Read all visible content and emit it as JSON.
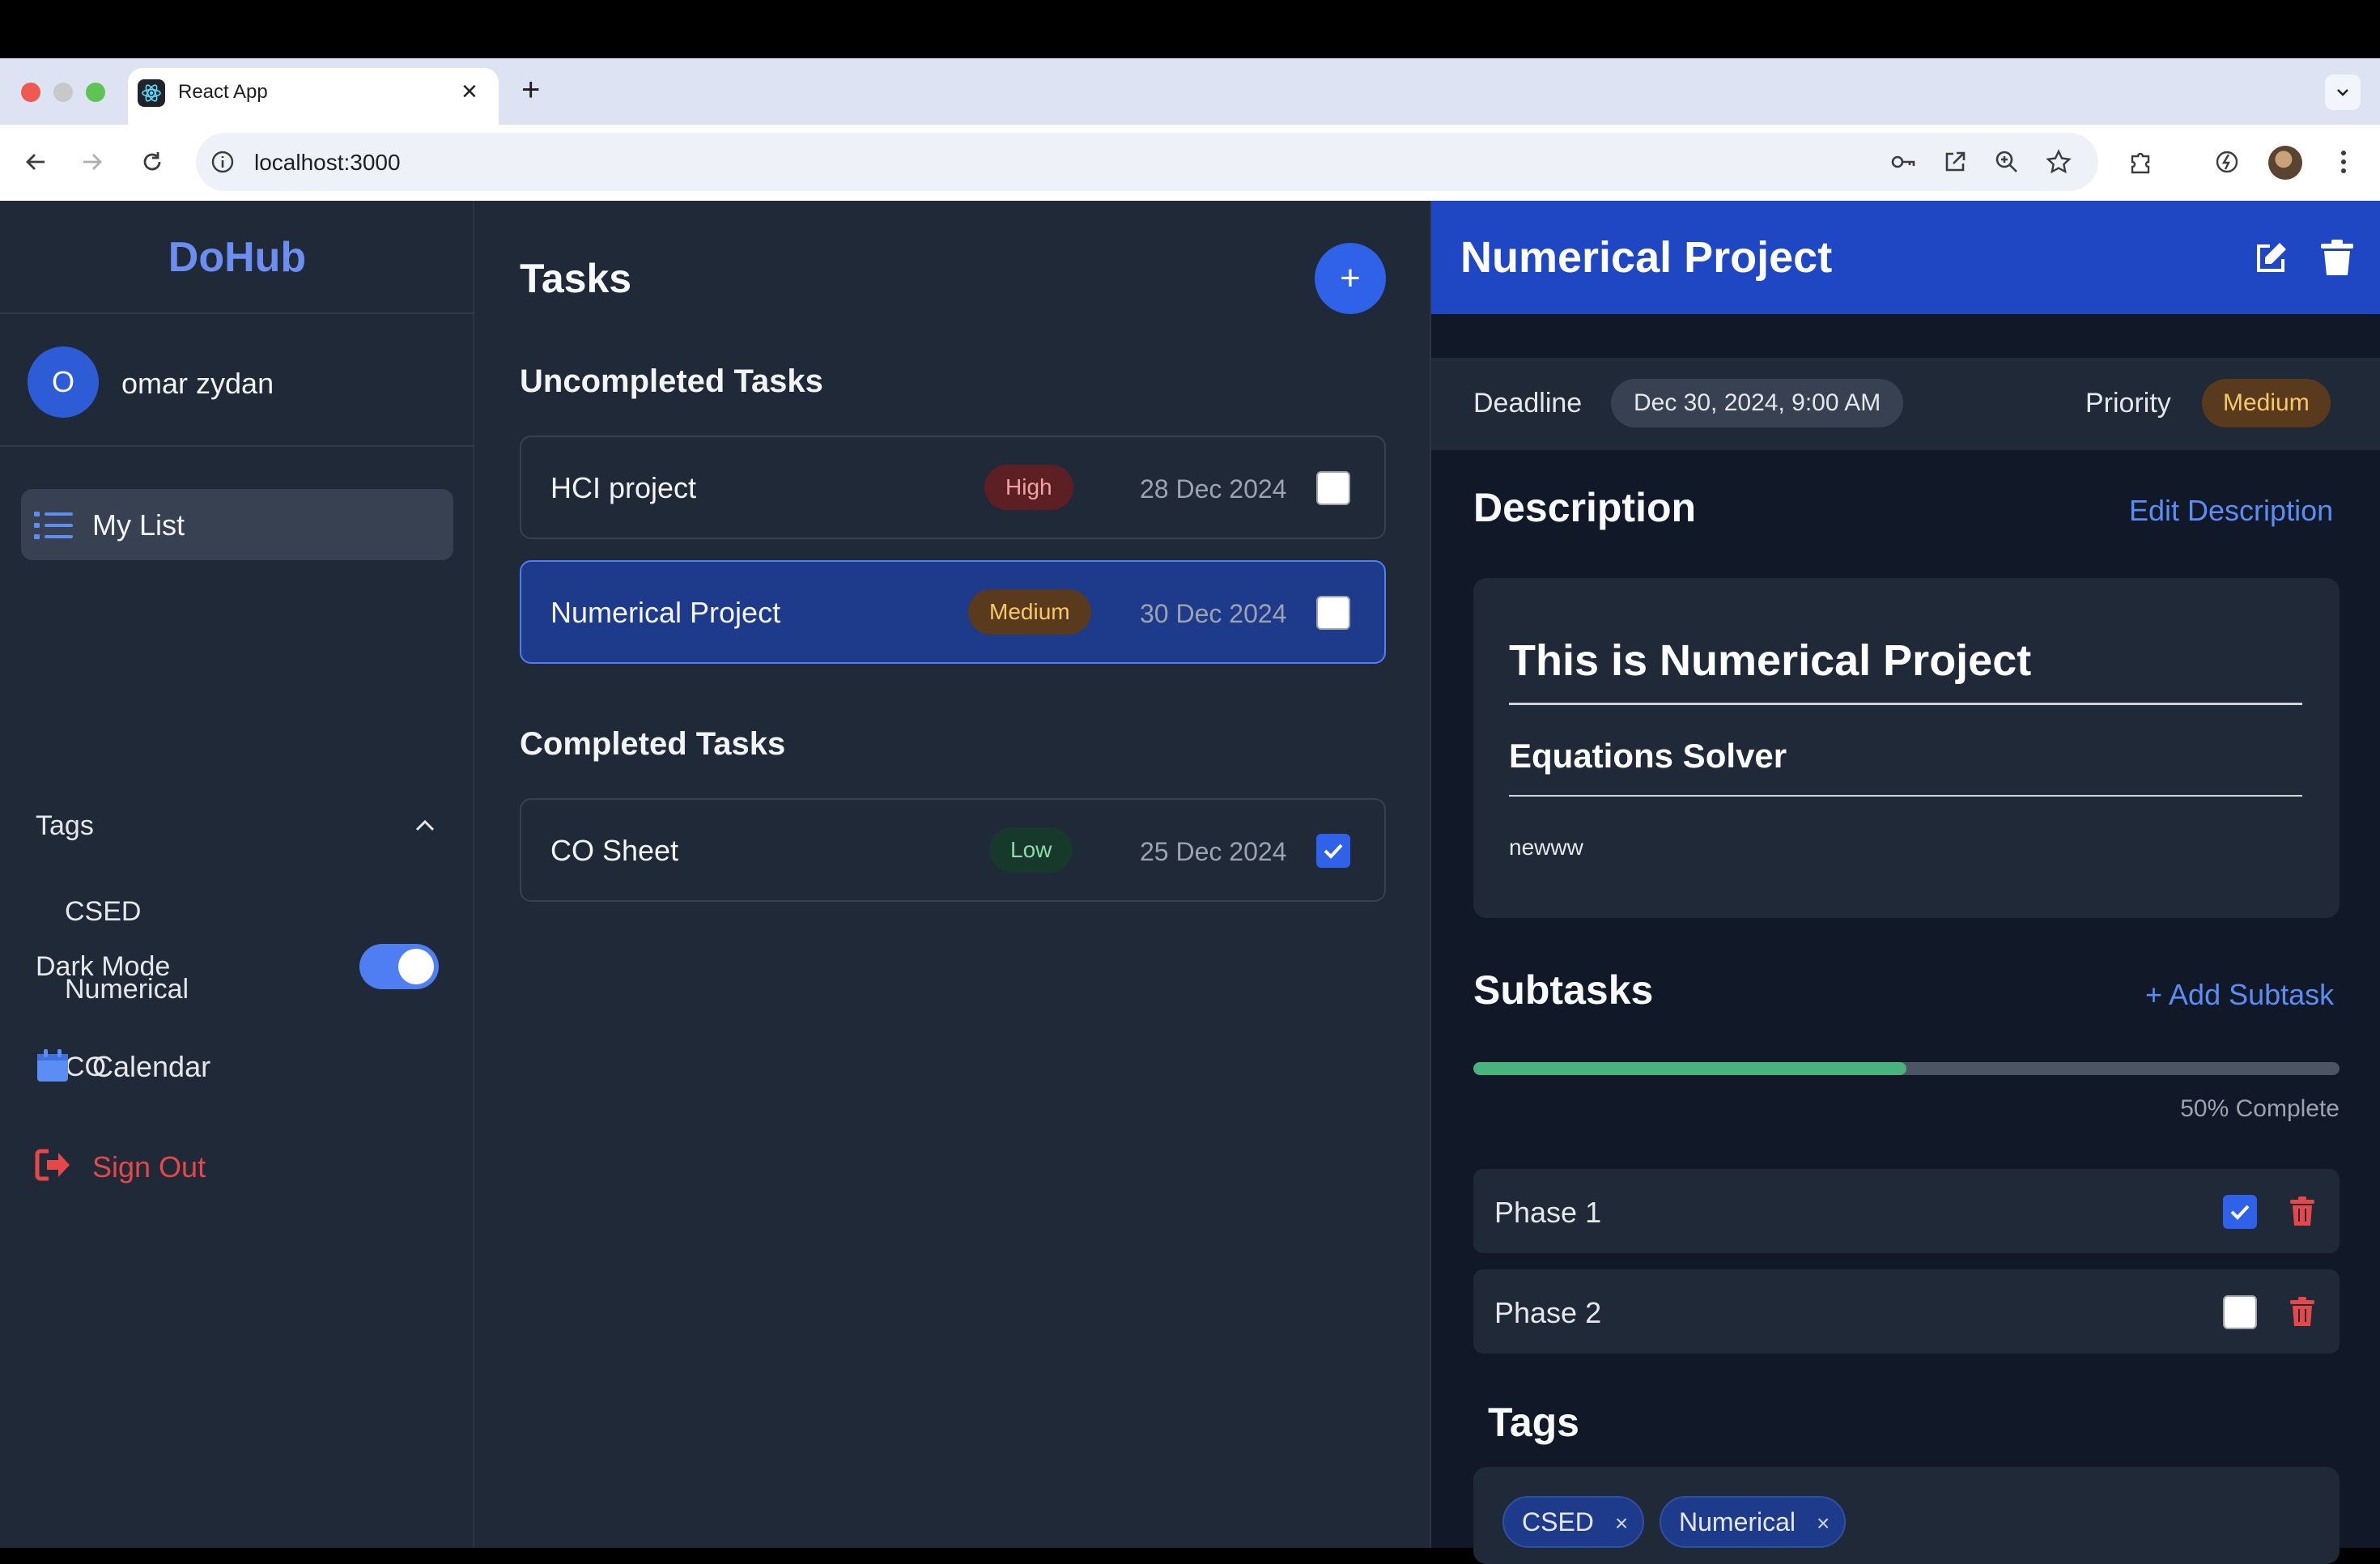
{
  "browser": {
    "tab_title": "React App",
    "tab_close": "×",
    "new_tab": "+",
    "url": "localhost:3000"
  },
  "sidebar": {
    "brand": "DoHub",
    "user": {
      "initial": "O",
      "name": "omar zydan"
    },
    "my_list": "My List",
    "tags_heading": "Tags",
    "tags": [
      "CSED",
      "Numerical",
      "CO"
    ],
    "dark_mode_label": "Dark Mode",
    "dark_mode_on": true,
    "calendar": "Calendar",
    "sign_out": "Sign Out"
  },
  "tasks": {
    "title": "Tasks",
    "add_button": "+",
    "uncompleted_heading": "Uncompleted Tasks",
    "completed_heading": "Completed Tasks",
    "uncompleted": [
      {
        "title": "HCI project",
        "priority": "High",
        "date": "28 Dec 2024",
        "done": false,
        "selected": false
      },
      {
        "title": "Numerical Project",
        "priority": "Medium",
        "date": "30 Dec 2024",
        "done": false,
        "selected": true
      }
    ],
    "completed": [
      {
        "title": "CO Sheet",
        "priority": "Low",
        "date": "25 Dec 2024",
        "done": true,
        "selected": false
      }
    ]
  },
  "detail": {
    "title": "Numerical Project",
    "deadline_label": "Deadline",
    "deadline": "Dec 30, 2024, 9:00 AM",
    "priority_label": "Priority",
    "priority": "Medium",
    "description_heading": "Description",
    "edit_description": "Edit Description",
    "description": {
      "h1": "This is Numerical Project",
      "h2": "Equations Solver",
      "p": "newww"
    },
    "subtasks_heading": "Subtasks",
    "add_subtask": "+ Add Subtask",
    "progress_percent": 50,
    "progress_text": "50% Complete",
    "subtasks": [
      {
        "title": "Phase 1",
        "done": true
      },
      {
        "title": "Phase 2",
        "done": false
      }
    ],
    "tags_heading": "Tags",
    "tags": [
      {
        "label": "CSED",
        "remove": "×"
      },
      {
        "label": "Numerical",
        "remove": "×"
      }
    ]
  },
  "colors": {
    "accent": "#2f62e8",
    "brand": "#6b8ef0",
    "danger": "#e54848",
    "success": "#48b37c"
  }
}
